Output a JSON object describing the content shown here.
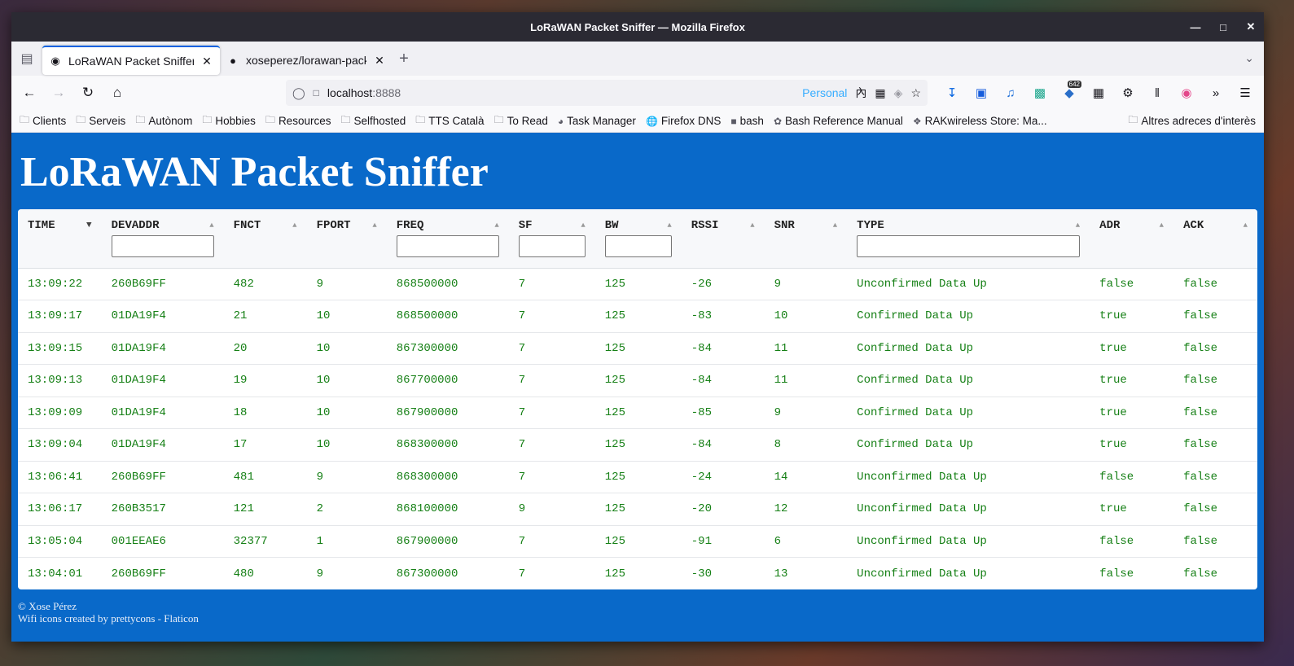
{
  "window": {
    "title": "LoRaWAN Packet Sniffer — Mozilla Firefox"
  },
  "tabs": [
    {
      "title": "LoRaWAN Packet Sniffer",
      "active": true
    },
    {
      "title": "xoseperez/lorawan-packet-",
      "active": false
    }
  ],
  "urlbar": {
    "host": "localhost",
    "port": ":8888",
    "container": "Personal"
  },
  "toolbar": {
    "badge_count": "642"
  },
  "bookmarks": [
    "Clients",
    "Serveis",
    "Autònom",
    "Hobbies",
    "Resources",
    "Selfhosted",
    "TTS Català",
    "To Read",
    "Task Manager",
    "Firefox DNS",
    "bash",
    "Bash Reference Manual",
    "RAKwireless Store: Ma..."
  ],
  "bookmarks_other": "Altres adreces d'interès",
  "page": {
    "title": "LoRaWAN Packet Sniffer",
    "footer_line1": "© Xose Pérez",
    "footer_line2": "Wifi icons created by prettycons - Flaticon"
  },
  "table": {
    "columns": [
      {
        "label": "TIME",
        "filter": false,
        "sorted": true
      },
      {
        "label": "DEVADDR",
        "filter": true,
        "sorted": false
      },
      {
        "label": "FNCT",
        "filter": false,
        "sorted": false
      },
      {
        "label": "FPORT",
        "filter": false,
        "sorted": false
      },
      {
        "label": "FREQ",
        "filter": true,
        "sorted": false
      },
      {
        "label": "SF",
        "filter": true,
        "sorted": false
      },
      {
        "label": "BW",
        "filter": true,
        "sorted": false
      },
      {
        "label": "RSSI",
        "filter": false,
        "sorted": false
      },
      {
        "label": "SNR",
        "filter": false,
        "sorted": false
      },
      {
        "label": "TYPE",
        "filter": true,
        "sorted": false
      },
      {
        "label": "ADR",
        "filter": false,
        "sorted": false
      },
      {
        "label": "ACK",
        "filter": false,
        "sorted": false
      }
    ],
    "rows": [
      [
        "13:09:22",
        "260B69FF",
        "482",
        "9",
        "868500000",
        "7",
        "125",
        "-26",
        "9",
        "Unconfirmed Data Up",
        "false",
        "false"
      ],
      [
        "13:09:17",
        "01DA19F4",
        "21",
        "10",
        "868500000",
        "7",
        "125",
        "-83",
        "10",
        "Confirmed Data Up",
        "true",
        "false"
      ],
      [
        "13:09:15",
        "01DA19F4",
        "20",
        "10",
        "867300000",
        "7",
        "125",
        "-84",
        "11",
        "Confirmed Data Up",
        "true",
        "false"
      ],
      [
        "13:09:13",
        "01DA19F4",
        "19",
        "10",
        "867700000",
        "7",
        "125",
        "-84",
        "11",
        "Confirmed Data Up",
        "true",
        "false"
      ],
      [
        "13:09:09",
        "01DA19F4",
        "18",
        "10",
        "867900000",
        "7",
        "125",
        "-85",
        "9",
        "Confirmed Data Up",
        "true",
        "false"
      ],
      [
        "13:09:04",
        "01DA19F4",
        "17",
        "10",
        "868300000",
        "7",
        "125",
        "-84",
        "8",
        "Confirmed Data Up",
        "true",
        "false"
      ],
      [
        "13:06:41",
        "260B69FF",
        "481",
        "9",
        "868300000",
        "7",
        "125",
        "-24",
        "14",
        "Unconfirmed Data Up",
        "false",
        "false"
      ],
      [
        "13:06:17",
        "260B3517",
        "121",
        "2",
        "868100000",
        "9",
        "125",
        "-20",
        "12",
        "Unconfirmed Data Up",
        "true",
        "false"
      ],
      [
        "13:05:04",
        "001EEAE6",
        "32377",
        "1",
        "867900000",
        "7",
        "125",
        "-91",
        "6",
        "Unconfirmed Data Up",
        "false",
        "false"
      ],
      [
        "13:04:01",
        "260B69FF",
        "480",
        "9",
        "867300000",
        "7",
        "125",
        "-30",
        "13",
        "Unconfirmed Data Up",
        "false",
        "false"
      ]
    ]
  }
}
